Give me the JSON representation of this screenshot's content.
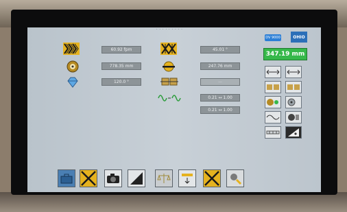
{
  "screen": {
    "top_marker": "· · · · · · · · ·",
    "badge_blue": "DV 9000",
    "brand": "OHIO",
    "measurement_display": "347.19 mm"
  },
  "fields": {
    "speed": "60.92 fpm",
    "length": "778.35 mm",
    "angle": "120.0 °",
    "angle2": "45.01 °",
    "width": "247.76 mm",
    "dimmed": "—",
    "range1": "0.21 ↔ 1.00",
    "range2": "0.21 ↔ 1.00"
  },
  "colors": {
    "screen_bg": "#c3ccd3",
    "field_bg": "#8d9498",
    "accent_yellow": "#e5b21f",
    "accent_green": "#36b84a",
    "accent_blue": "#2c7fd6"
  },
  "icons": {
    "left": [
      "zigzag-pattern-icon",
      "dial-icon",
      "diamond-icon"
    ],
    "center": [
      "zigzag-pattern-icon",
      "horizontal-cutter-icon",
      "rollers-icon",
      "wave-signal-icon"
    ],
    "right_tools": [
      "arrow-left-right-icon",
      "arrow-left-right-icon",
      "rollers-icon",
      "rollers-icon",
      "dial-green-icon",
      "dial-icon",
      "wave-icon",
      "roller-icon",
      "measure-icon",
      "half-triangle-icon"
    ],
    "dock": [
      "toolbox-icon",
      "zigzag-pattern-icon",
      "camera-icon",
      "half-triangle-icon",
      "balance-icon",
      "sizing-icon",
      "zigzag-pattern-icon",
      "settings-icon"
    ]
  }
}
